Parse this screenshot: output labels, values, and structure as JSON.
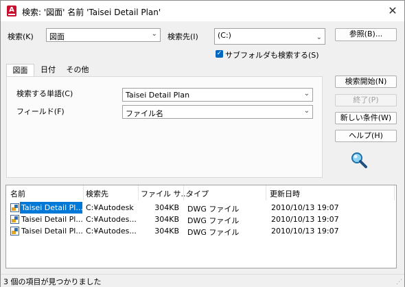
{
  "window": {
    "title": "検索: '図面' 名前 'Taisei Detail Plan'",
    "close_glyph": "✕",
    "app_icon_letter": "A"
  },
  "search": {
    "search_label": "検索(K)",
    "search_value": "図面",
    "location_label": "検索先(I)",
    "location_value": "(C:)",
    "browse_button": "参照(B)...",
    "subfolders_label": "サブフォルダも検索する(S)",
    "subfolders_checked": true
  },
  "tabs": [
    "図面",
    "日付",
    "その他"
  ],
  "panel": {
    "word_label": "検索する単語(C)",
    "word_value": "Taisei Detail Plan",
    "field_label": "フィールド(F)",
    "field_value": "ファイル名"
  },
  "actions": {
    "start": "検索開始(N)",
    "stop": "終了(P)",
    "new_condition": "新しい条件(W)",
    "help": "ヘルプ(H)"
  },
  "results": {
    "columns": [
      "名前",
      "検索先",
      "ファイル サ...",
      "タイプ",
      "更新日時"
    ],
    "rows": [
      {
        "name": "Taisei Detail Pl...",
        "location": "C:¥Autodesk",
        "size": "304KB",
        "type": "DWG ファイル",
        "modified": "2010/10/13 19:07"
      },
      {
        "name": "Taisei Detail Pl...",
        "location": "C:¥Autodes...",
        "size": "304KB",
        "type": "DWG ファイル",
        "modified": "2010/10/13 19:07"
      },
      {
        "name": "Taisei Detail Pl...",
        "location": "C:¥Autodes...",
        "size": "304KB",
        "type": "DWG ファイル",
        "modified": "2010/10/13 19:07"
      }
    ]
  },
  "status": {
    "text": "3 個の項目が見つかりました"
  },
  "colors": {
    "accent": "#0067c0",
    "selection": "#0078d7",
    "app_icon": "#c8102e"
  }
}
